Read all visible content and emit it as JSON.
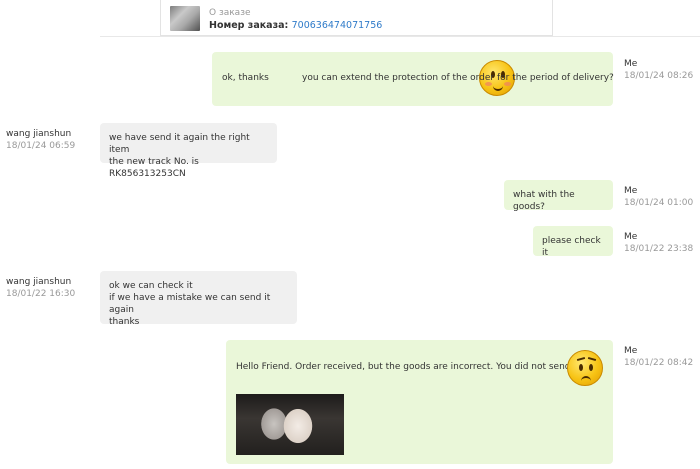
{
  "order": {
    "title": "О заказе",
    "number_label": "Номер заказа:",
    "number": "700636474071756"
  },
  "messages": [
    {
      "sender": "Me",
      "time": "18/01/24 08:26",
      "text_before": "ok, thanks",
      "emoji": "happy-emoji",
      "text_after": " you can extend the protection of the order for the period of delivery?"
    },
    {
      "sender": "wang jianshun",
      "time": "18/01/24 06:59",
      "lines": [
        "we have send it again the right item",
        "the new track No. is RK856313253CN"
      ]
    },
    {
      "sender": "Me",
      "time": "18/01/24 01:00",
      "text": "what with the goods?"
    },
    {
      "sender": "Me",
      "time": "18/01/22 23:38",
      "text": "please check it"
    },
    {
      "sender": "wang jianshun",
      "time": "18/01/22 16:30",
      "lines": [
        "ok we can check it",
        "if we have a mistake we can send it again",
        "thanks"
      ]
    },
    {
      "sender": "Me",
      "time": "18/01/22 08:42",
      "text": "Hello Friend. Order received, but the goods are incorrect. You did not send it.",
      "emoji": "sad-emoji",
      "attachment": "photo-of-received-goods"
    }
  ]
}
